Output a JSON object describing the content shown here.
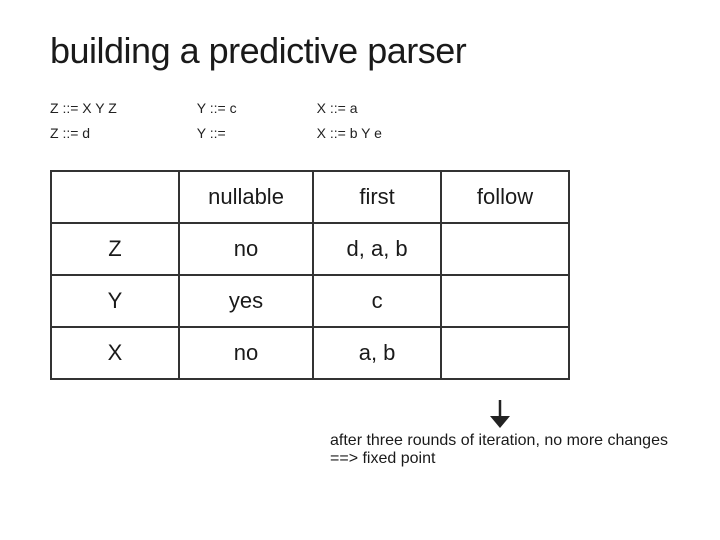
{
  "title": "building a predictive parser",
  "grammar": {
    "left_rules": [
      "Z ::= X Y Z",
      "Z ::= d"
    ],
    "middle_rules": [
      "Y ::= c",
      "Y ::="
    ],
    "right_rules": [
      "X ::= a",
      "X ::= b Y e"
    ]
  },
  "table": {
    "headers": [
      "",
      "nullable",
      "first",
      "follow"
    ],
    "rows": [
      {
        "symbol": "Z",
        "nullable": "no",
        "first": "d, a, b",
        "follow": ""
      },
      {
        "symbol": "Y",
        "nullable": "yes",
        "first": "c",
        "follow": ""
      },
      {
        "symbol": "X",
        "nullable": "no",
        "first": "a, b",
        "follow": ""
      }
    ]
  },
  "footer": "after three rounds of iteration, no more changes ==> fixed point"
}
